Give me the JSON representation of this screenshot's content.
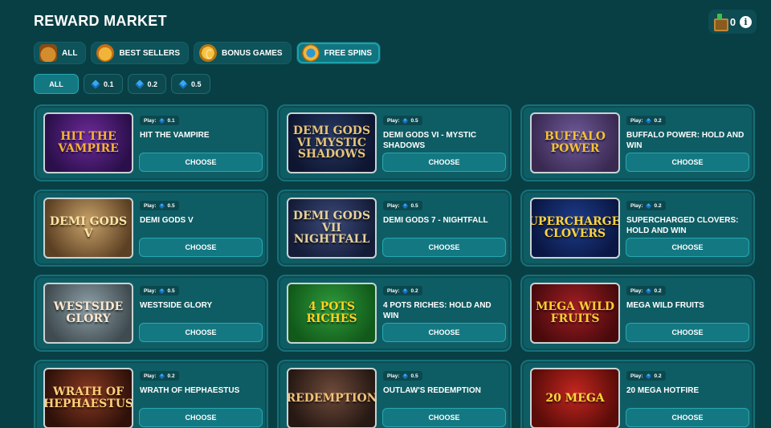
{
  "header": {
    "title": "REWARD MARKET",
    "wallet_count": "0",
    "info_icon": "info-icon",
    "chest_icon": "chest-icon"
  },
  "category_tabs": [
    {
      "label": "ALL",
      "icon": "chest-icon",
      "active": false
    },
    {
      "label": "BEST SELLERS",
      "icon": "medal-icon",
      "active": false
    },
    {
      "label": "BONUS GAMES",
      "icon": "coin-icon",
      "active": false
    },
    {
      "label": "FREE SPINS",
      "icon": "wheel-icon",
      "active": true
    }
  ],
  "price_tabs": [
    {
      "label": "ALL",
      "gem": false,
      "active": true
    },
    {
      "label": "0.1",
      "gem": true,
      "active": false
    },
    {
      "label": "0.2",
      "gem": true,
      "active": false
    },
    {
      "label": "0.5",
      "gem": true,
      "active": false
    }
  ],
  "play_label": "Play:",
  "choose_label": "CHOOSE",
  "games": [
    {
      "name": "HIT THE VAMPIRE",
      "price": "0.1",
      "art": "HIT THE VAMPIRE",
      "bg": "#6d2a9a",
      "bg2": "#2a0f4a",
      "fg": "#f6b13d"
    },
    {
      "name": "DEMI GODS VI - MYSTIC SHADOWS",
      "price": "0.5",
      "art": "DEMI GODS VI MYSTIC SHADOWS",
      "bg": "#283a66",
      "bg2": "#0e1530",
      "fg": "#e6c47a"
    },
    {
      "name": "BUFFALO POWER: HOLD AND WIN",
      "price": "0.2",
      "art": "BUFFALO POWER",
      "bg": "#6f5a9a",
      "bg2": "#3a2a52",
      "fg": "#f3c13a"
    },
    {
      "name": "DEMI GODS V",
      "price": "0.5",
      "art": "DEMI GODS V",
      "bg": "#c9a36a",
      "bg2": "#5c4023",
      "fg": "#ffe6a3"
    },
    {
      "name": "DEMI GODS 7 - NIGHTFALL",
      "price": "0.5",
      "art": "DEMI GODS VII NIGHTFALL",
      "bg": "#3b4a7a",
      "bg2": "#141c38",
      "fg": "#e7d29a"
    },
    {
      "name": "SUPERCHARGED CLOVERS: HOLD AND WIN",
      "price": "0.2",
      "art": "SUPERCHARGED CLOVERS",
      "bg": "#1d3d8c",
      "bg2": "#0a1744",
      "fg": "#ffd33c"
    },
    {
      "name": "WESTSIDE GLORY",
      "price": "0.5",
      "art": "WESTSIDE GLORY",
      "bg": "#8fa1a8",
      "bg2": "#3f4b4f",
      "fg": "#ffe8d0"
    },
    {
      "name": "4 POTS RICHES: HOLD AND WIN",
      "price": "0.2",
      "art": "4 POTS RICHES",
      "bg": "#2f9a3a",
      "bg2": "#115a1a",
      "fg": "#ffd21f"
    },
    {
      "name": "MEGA WILD FRUITS",
      "price": "0.2",
      "art": "MEGA WILD FRUITS",
      "bg": "#a01e24",
      "bg2": "#4a0a0c",
      "fg": "#ffcc33"
    },
    {
      "name": "WRATH OF HEPHAESTUS",
      "price": "0.2",
      "art": "WRATH OF HEPHAESTUS",
      "bg": "#8a3a22",
      "bg2": "#2f110a",
      "fg": "#ffcf7a"
    },
    {
      "name": "OUTLAW'S REDEMPTION",
      "price": "0.5",
      "art": "REDEMPTION",
      "bg": "#6e4a3a",
      "bg2": "#261813",
      "fg": "#f2c27a"
    },
    {
      "name": "20 MEGA HOTFIRE",
      "price": "0.2",
      "art": "20 MEGA",
      "bg": "#c2261f",
      "bg2": "#5a0c09",
      "fg": "#ffd83a"
    }
  ]
}
